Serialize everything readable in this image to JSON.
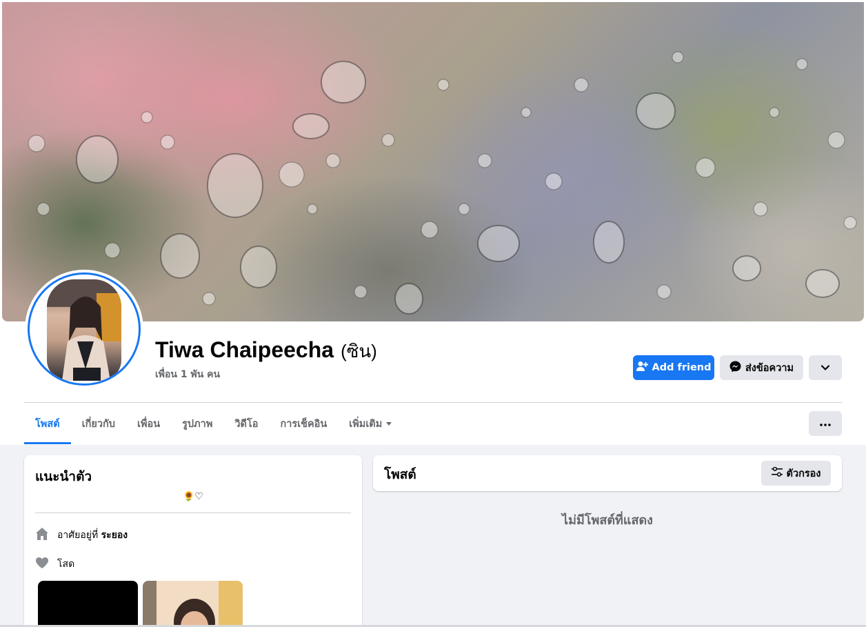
{
  "profile": {
    "name": "Tiwa Chaipeecha",
    "alternate_name": "(ซิน)",
    "friends_count": "เพื่อน 1 พัน คน"
  },
  "actions": {
    "add_friend": "Add friend",
    "message": "ส่งข้อความ",
    "more_icon": "chevron-down-icon",
    "overflow_icon": "three-dots-icon"
  },
  "tabs": [
    {
      "label": "โพสต์",
      "active": true
    },
    {
      "label": "เกี่ยวกับ",
      "active": false
    },
    {
      "label": "เพื่อน",
      "active": false
    },
    {
      "label": "รูปภาพ",
      "active": false
    },
    {
      "label": "วิดีโอ",
      "active": false
    },
    {
      "label": "การเช็คอิน",
      "active": false
    },
    {
      "label": "เพิ่มเติม",
      "active": false
    }
  ],
  "intro": {
    "title": "แนะนำตัว",
    "bio": "🌻♡",
    "lives_in_prefix": "อาศัยอยู่ที่",
    "lives_in_place": "ระยอง",
    "relationship": "โสด"
  },
  "posts": {
    "title": "โพสต์",
    "filter_label": "ตัวกรอง",
    "empty_message": "ไม่มีโพสต์ที่แสดง"
  },
  "colors": {
    "accent": "#1877f2",
    "page_bg": "#f0f2f5",
    "secondary_button": "#e4e6eb",
    "secondary_text": "#65676b"
  }
}
